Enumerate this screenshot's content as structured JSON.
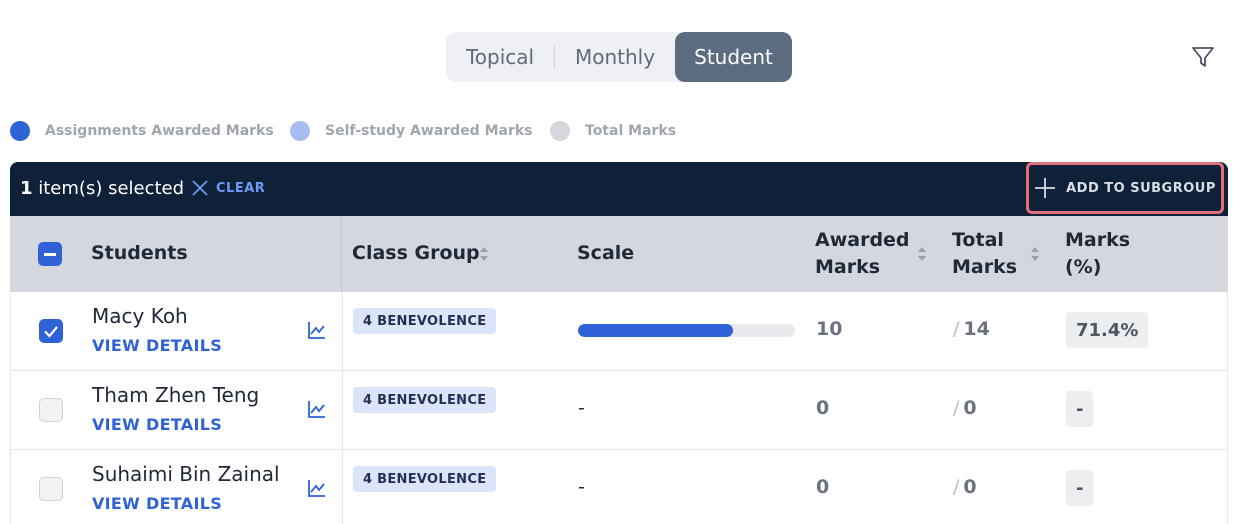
{
  "tabs": [
    {
      "label": "Topical"
    },
    {
      "label": "Monthly"
    },
    {
      "label": "Student",
      "active": true
    }
  ],
  "filter": {
    "icon": "filter-icon"
  },
  "legend": [
    {
      "label": "Assignments Awarded Marks",
      "color": "#2f62d6"
    },
    {
      "label": "Self-study Awarded Marks",
      "color": "#a7bdf2"
    },
    {
      "label": "Total Marks",
      "color": "#d4d7dc"
    }
  ],
  "selection": {
    "count": "1",
    "count_suffix": " item(s) selected",
    "clear_label": "CLEAR",
    "add_label": "ADD TO SUBGROUP"
  },
  "columns": {
    "students": "Students",
    "class_group": "Class Group",
    "scale": "Scale",
    "awarded_1": "Awarded",
    "awarded_2": "Marks",
    "total_1": "Total",
    "total_2": "Marks",
    "marks_1": "Marks",
    "marks_2": "(%)"
  },
  "rows": [
    {
      "name": "Macy Koh",
      "view": "VIEW DETAILS",
      "group": "4 BENEVOLENCE",
      "scale_fraction": 0.714,
      "scale_text": "",
      "awarded": "10",
      "total": "14",
      "pct": "71.4%",
      "checked": true
    },
    {
      "name": "Tham Zhen Teng",
      "view": "VIEW DETAILS",
      "group": "4 BENEVOLENCE",
      "scale_fraction": null,
      "scale_text": "-",
      "awarded": "0",
      "total": "0",
      "pct": "-",
      "checked": false
    },
    {
      "name": "Suhaimi Bin Zainal",
      "view": "VIEW DETAILS",
      "group": "4 BENEVOLENCE",
      "scale_fraction": null,
      "scale_text": "-",
      "awarded": "0",
      "total": "0",
      "pct": "-",
      "checked": false
    }
  ],
  "colors": {
    "accent": "#2f62d6",
    "header_dark": "#0f2138",
    "highlight_border": "#e0707a"
  }
}
